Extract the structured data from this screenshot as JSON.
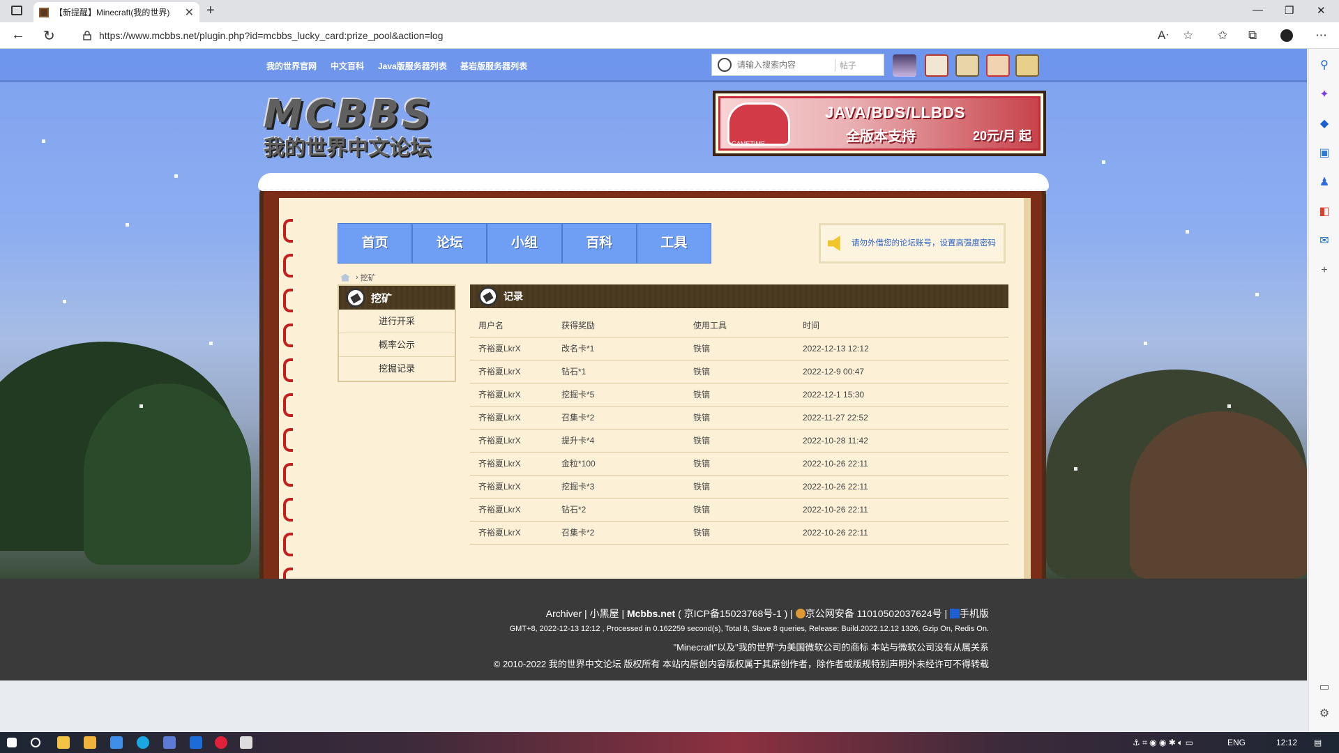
{
  "browser": {
    "tab_title": "【新提醒】Minecraft(我的世界)",
    "url": "https://www.mcbbs.net/plugin.php?id=mcbbs_lucky_card:prize_pool&action=log"
  },
  "topnav": {
    "links": [
      "我的世界官网",
      "中文百科",
      "Java版服务器列表",
      "基岩版服务器列表"
    ],
    "search_placeholder": "请输入搜索内容",
    "search_type": "帖子"
  },
  "logo": {
    "line1": "MCBBS",
    "line2": "我的世界中文论坛"
  },
  "banner": {
    "line1": "JAVA/BDS/LLBDS",
    "line2": "全版本支持",
    "line3": "20元/月 起",
    "brand": "GAMETIME"
  },
  "mainnav": [
    "首页",
    "论坛",
    "小组",
    "百科",
    "工具"
  ],
  "notice": "请勿外借您的论坛账号，设置高强度密码",
  "breadcrumb": {
    "current": "挖矿"
  },
  "sidebar": {
    "title": "挖矿",
    "items": [
      "进行开采",
      "概率公示",
      "挖掘记录"
    ]
  },
  "log": {
    "title": "记录",
    "columns": [
      "用户名",
      "获得奖励",
      "使用工具",
      "时间"
    ],
    "rows": [
      [
        "齐裕夏LkrX",
        "改名卡*1",
        "铁镐",
        "2022-12-13 12:12"
      ],
      [
        "齐裕夏LkrX",
        "钻石*1",
        "铁镐",
        "2022-12-9 00:47"
      ],
      [
        "齐裕夏LkrX",
        "挖掘卡*5",
        "铁镐",
        "2022-12-1 15:30"
      ],
      [
        "齐裕夏LkrX",
        "召集卡*2",
        "铁镐",
        "2022-11-27 22:52"
      ],
      [
        "齐裕夏LkrX",
        "提升卡*4",
        "铁镐",
        "2022-10-28 11:42"
      ],
      [
        "齐裕夏LkrX",
        "金粒*100",
        "铁镐",
        "2022-10-26 22:11"
      ],
      [
        "齐裕夏LkrX",
        "挖掘卡*3",
        "铁镐",
        "2022-10-26 22:11"
      ],
      [
        "齐裕夏LkrX",
        "钻石*2",
        "铁镐",
        "2022-10-26 22:11"
      ],
      [
        "齐裕夏LkrX",
        "召集卡*2",
        "铁镐",
        "2022-10-26 22:11"
      ]
    ]
  },
  "footer": {
    "archiver": "Archiver",
    "blackroom": "小黑屋",
    "site": "Mcbbs.net",
    "icp": "( 京ICP备15023768号-1 )",
    "police": "京公网安备 11010502037624号",
    "mobile": "手机版",
    "stats": "GMT+8, 2022-12-13 12:12 , Processed in 0.162259 second(s), Total 8, Slave 8 queries, Release: Build.2022.12.12 1326, Gzip On, Redis On.",
    "trademark": "\"Minecraft\"以及\"我的世界\"为美国微软公司的商标 本站与微软公司没有从属关系",
    "copyright": "© 2010-2022 我的世界中文论坛 版权所有 本站内原创内容版权属于其原创作者，除作者或版规特别声明外未经许可不得转载"
  },
  "taskbar": {
    "lang": "ENG",
    "time": "12:12"
  }
}
